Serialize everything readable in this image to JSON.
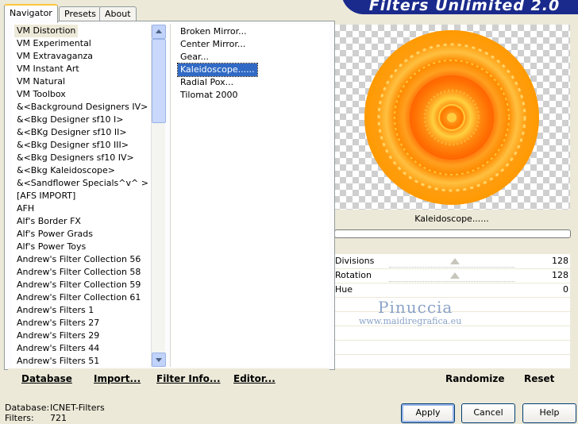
{
  "banner": {
    "title": "Filters Unlimited 2.0"
  },
  "tabs": [
    {
      "label": "Navigator"
    },
    {
      "label": "Presets"
    },
    {
      "label": "About"
    }
  ],
  "categories": [
    {
      "label": "VM Distortion"
    },
    {
      "label": "VM Experimental"
    },
    {
      "label": "VM Extravaganza"
    },
    {
      "label": "VM Instant Art"
    },
    {
      "label": "VM Natural"
    },
    {
      "label": "VM Toolbox"
    },
    {
      "label": "&<Background Designers IV>"
    },
    {
      "label": "&<Bkg Designer sf10 I>"
    },
    {
      "label": "&<BKg Designer sf10 II>"
    },
    {
      "label": "&<Bkg Designer sf10 III>"
    },
    {
      "label": "&<Bkg Designers sf10 IV>"
    },
    {
      "label": "&<Bkg Kaleidoscope>"
    },
    {
      "label": "&<Sandflower Specials^v^ >"
    },
    {
      "label": "[AFS IMPORT]"
    },
    {
      "label": "AFH"
    },
    {
      "label": "Alf's Border FX"
    },
    {
      "label": "Alf's Power Grads"
    },
    {
      "label": "Alf's Power Toys"
    },
    {
      "label": "Andrew's Filter Collection 56"
    },
    {
      "label": "Andrew's Filter Collection 58"
    },
    {
      "label": "Andrew's Filter Collection 59"
    },
    {
      "label": "Andrew's Filter Collection 61"
    },
    {
      "label": "Andrew's Filters 1"
    },
    {
      "label": "Andrew's Filters 27"
    },
    {
      "label": "Andrew's Filters 29"
    },
    {
      "label": "Andrew's Filters 44"
    },
    {
      "label": "Andrew's Filters 51"
    }
  ],
  "filters": [
    {
      "label": "Broken Mirror..."
    },
    {
      "label": "Center Mirror..."
    },
    {
      "label": "Gear..."
    },
    {
      "label": "Kaleidoscope......"
    },
    {
      "label": "Radial Pox..."
    },
    {
      "label": "Tilomat 2000"
    }
  ],
  "list_buttons": {
    "database": "Database",
    "import": "Import...",
    "filter_info": "Filter Info...",
    "editor": "Editor..."
  },
  "preview": {
    "filter_name": "Kaleidoscope......"
  },
  "params": [
    {
      "label": "Divisions",
      "value": "128"
    },
    {
      "label": "Rotation",
      "value": "128"
    },
    {
      "label": "Hue",
      "value": "0"
    }
  ],
  "watermark": {
    "line1": "Pinuccia",
    "line2": "www.maidiregrafica.eu"
  },
  "preview_buttons": {
    "randomize": "Randomize",
    "reset": "Reset"
  },
  "footer": {
    "database_label": "Database:",
    "database_value": "ICNET-Filters",
    "filters_label": "Filters:",
    "filters_value": "721",
    "apply": "Apply",
    "cancel": "Cancel",
    "help": "Help"
  },
  "colors": {
    "selection": "#316ac5",
    "banner": "#1a2a8c",
    "accent_tab": "#ffc83c"
  }
}
